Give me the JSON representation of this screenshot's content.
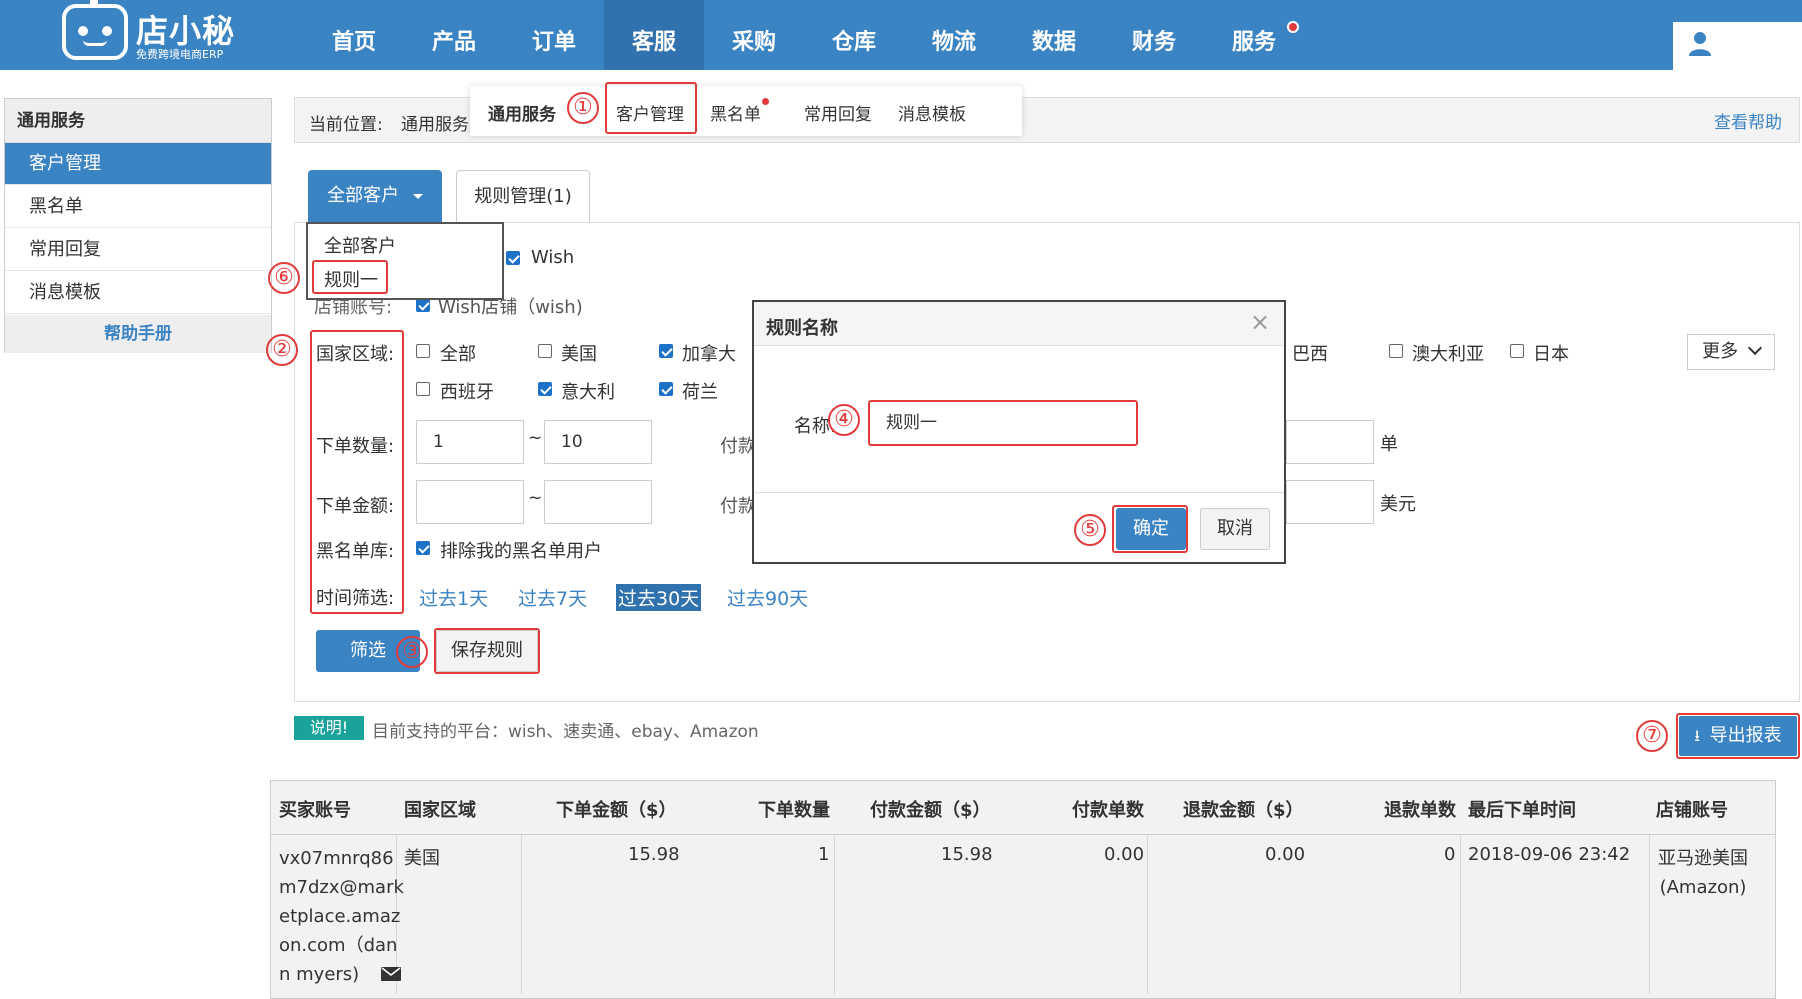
{
  "app": {
    "logo_text": "店小秘",
    "logo_sub": "免费跨境电商ERP"
  },
  "nav": {
    "items": [
      "首页",
      "产品",
      "订单",
      "客服",
      "采购",
      "仓库",
      "物流",
      "数据",
      "财务",
      "服务"
    ],
    "active": "客服"
  },
  "sidebar": {
    "title": "通用服务",
    "items": [
      "客户管理",
      "黑名单",
      "常用回复",
      "消息模板"
    ],
    "help": "帮助手册"
  },
  "breadcrumb": {
    "label": "当前位置:",
    "path": "通用服务",
    "help_link": "查看帮助"
  },
  "subnav": {
    "title": "通用服务",
    "items": [
      "客户管理",
      "黑名单",
      "常用回复",
      "消息模板"
    ]
  },
  "tabs": {
    "all": "全部客户",
    "rules": "规则管理(1)"
  },
  "dropdown": {
    "items": [
      "全部客户",
      "规则一"
    ]
  },
  "form": {
    "platform_wish": "Wish",
    "shop_label": "店铺账号:",
    "shop_value": "Wish店铺（wish)",
    "region_label": "国家区域:",
    "regions_row1": [
      "全部",
      "美国",
      "加拿大"
    ],
    "regions_row1_tail": [
      "巴西",
      "澳大利亚",
      "日本"
    ],
    "regions_row2": [
      "西班牙",
      "意大利",
      "荷兰"
    ],
    "more": "更多",
    "qty_label": "下单数量:",
    "qty_from": "1",
    "qty_to": "10",
    "amount_label": "下单金额:",
    "tilde": "~",
    "pay_label_1": "付款",
    "pay_label_2": "付款",
    "unit_1": "单",
    "unit_2": "美元",
    "blacklist_label": "黑名单库:",
    "blacklist_value": "排除我的黑名单用户",
    "time_label": "时间筛选:",
    "time_options": [
      "过去1天",
      "过去7天",
      "过去30天",
      "过去90天"
    ],
    "filter_btn": "筛选",
    "save_btn": "保存规则"
  },
  "modal": {
    "title": "规则名称",
    "close": "×",
    "name_label": "名称:",
    "name_value": "规则一",
    "ok": "确定",
    "cancel": "取消"
  },
  "note": {
    "badge": "说明!",
    "text": "目前支持的平台：wish、速卖通、ebay、Amazon"
  },
  "export_btn": "导出报表",
  "table": {
    "headers": [
      "买家账号",
      "国家区域",
      "下单金额（$）",
      "下单数量",
      "付款金额（$）",
      "付款单数",
      "退款金额（$）",
      "退款单数",
      "最后下单时间",
      "店铺账号"
    ],
    "row": {
      "buyer_lines": [
        "vx07mnrq86",
        "m7dzx@mark",
        "etplace.amaz",
        "on.com（dan",
        "n myers)"
      ],
      "region": "美国",
      "order_amount": "15.98",
      "order_qty": "1",
      "pay_amount": "15.98",
      "pay_count": "0.00",
      "refund_amount": "0.00",
      "refund_count": "0",
      "last_time": "2018-09-06 23:42",
      "shop_lines": [
        "亚马逊美国",
        "(Amazon)"
      ]
    }
  },
  "annotations": [
    "①",
    "②",
    "③",
    "④",
    "⑤",
    "⑥",
    "⑦"
  ],
  "colors": {
    "brand": "#3b84c4",
    "annotation": "#e23b3b",
    "note_badge": "#19a39b"
  }
}
